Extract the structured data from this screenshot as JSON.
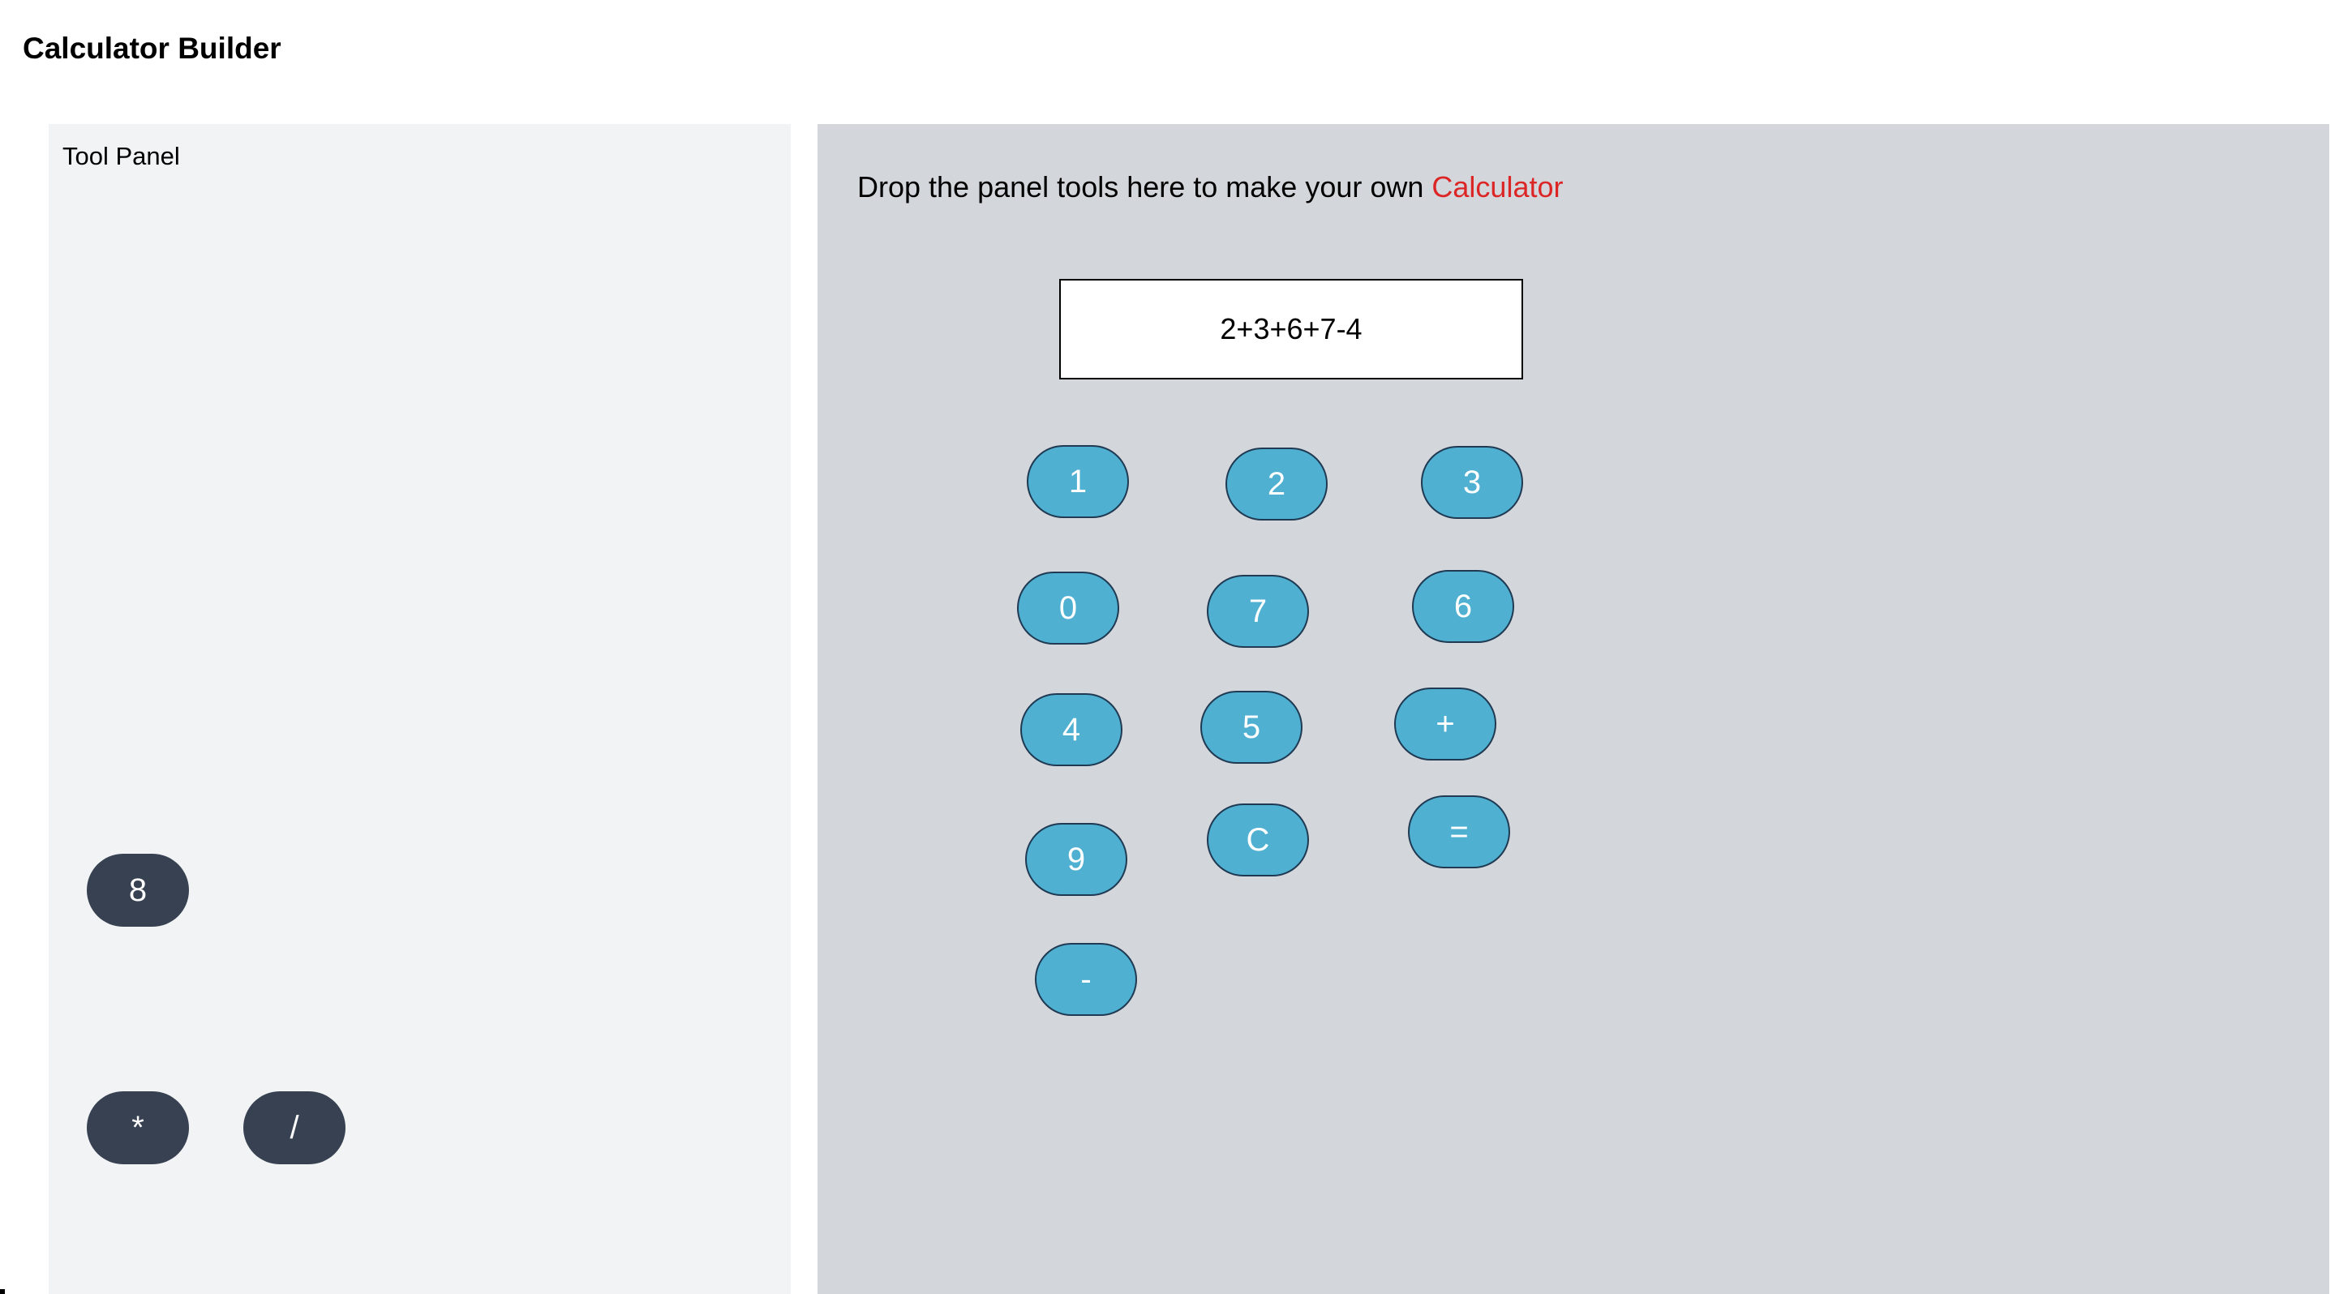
{
  "app": {
    "title": "Calculator Builder"
  },
  "tool_panel": {
    "title": "Tool Panel",
    "keys": [
      {
        "label": "8"
      },
      {
        "label": "*"
      },
      {
        "label": "/"
      }
    ]
  },
  "canvas": {
    "instruction_prefix": "Drop the panel tools here to make your own ",
    "instruction_accent": "Calculator",
    "display_value": "2+3+6+7-4",
    "keys": [
      {
        "label": "1"
      },
      {
        "label": "2"
      },
      {
        "label": "3"
      },
      {
        "label": "0"
      },
      {
        "label": "7"
      },
      {
        "label": "6"
      },
      {
        "label": "4"
      },
      {
        "label": "5"
      },
      {
        "label": "+"
      },
      {
        "label": "9"
      },
      {
        "label": "C"
      },
      {
        "label": "="
      },
      {
        "label": "-"
      }
    ]
  },
  "colors": {
    "placed_key": "#4fb0d1",
    "tool_key": "#374151",
    "accent": "#dc2626",
    "canvas_bg": "#d3d6db",
    "tool_panel_bg": "#f2f3f5"
  }
}
